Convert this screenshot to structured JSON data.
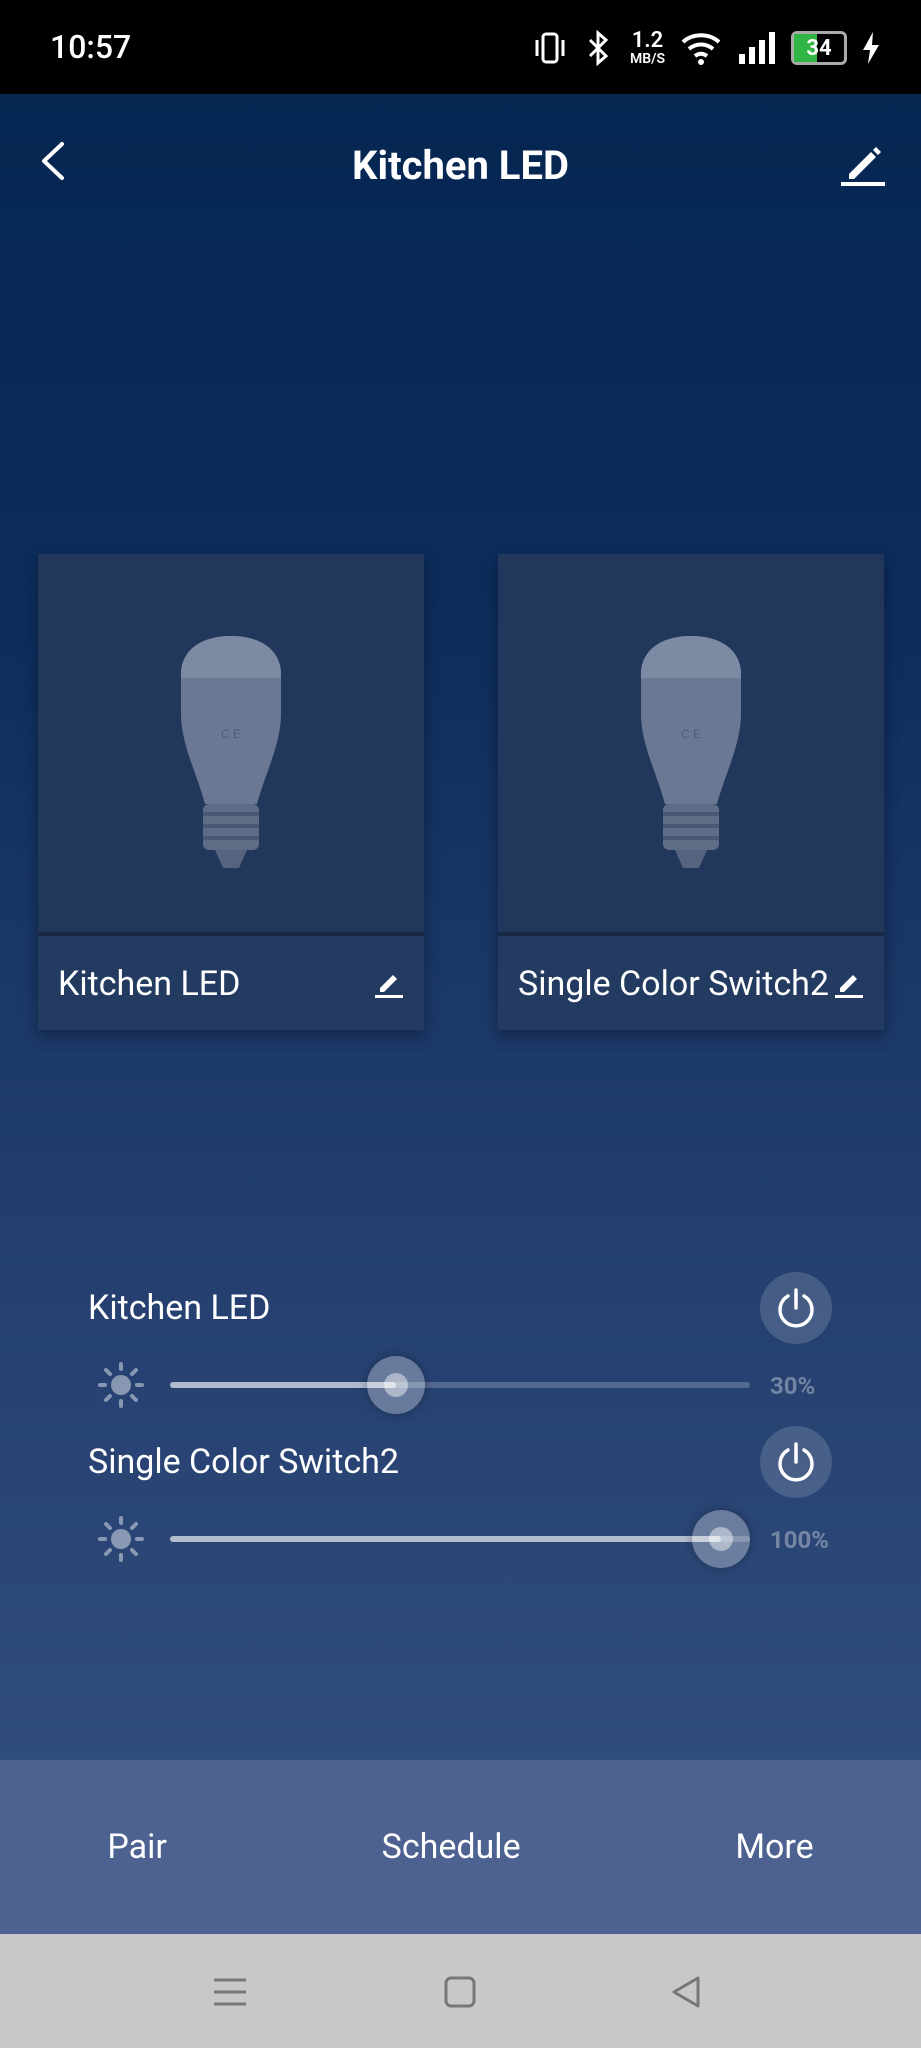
{
  "status_bar": {
    "time": "10:57",
    "net_speed_value": "1.2",
    "net_speed_unit": "MB/S",
    "battery_level": "34"
  },
  "header": {
    "title": "Kitchen LED"
  },
  "cards": [
    {
      "name": "Kitchen LED"
    },
    {
      "name": "Single Color Switch2"
    }
  ],
  "controls": [
    {
      "name": "Kitchen LED",
      "brightness_label": "30%",
      "brightness": 0.3
    },
    {
      "name": "Single Color Switch2",
      "brightness_label": "100%",
      "brightness": 1.0
    }
  ],
  "bottom_tabs": {
    "pair": "Pair",
    "schedule": "Schedule",
    "more": "More"
  },
  "colors": {
    "accent_battery": "#2fb543",
    "bottom_bar": "#4d6290"
  }
}
